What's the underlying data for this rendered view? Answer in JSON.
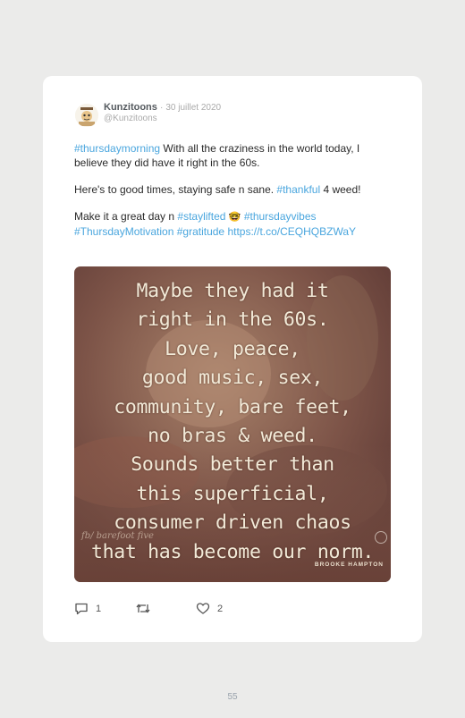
{
  "tweet": {
    "author_name": "Kunzitoons",
    "separator": "·",
    "date": "30 juillet 2020",
    "handle": "@Kunzitoons",
    "line1_tag": "#thursdaymorning",
    "line1_text": " With all the craziness in the world today, I believe they did have it right in the 60s.",
    "line2_text": "Here's to good times, staying safe n sane. ",
    "line2_tag": "#thankful",
    "line2_tail": " 4 weed!",
    "line3_text": "Make it a great day n ",
    "line3_tag1": "#staylifted",
    "line3_emoji": "🤓",
    "line3_tag2": " #thursdayvibes",
    "line3_tag3": "#ThursdayMotivation",
    "line3_tag4": " #gratitude",
    "line3_link": " https://t.co/CEQHQBZWaY"
  },
  "media": {
    "quote_lines": [
      "Maybe they had it",
      "right in the 60s.",
      "Love, peace,",
      "good music, sex,",
      "community, bare feet,",
      "no bras & weed.",
      "Sounds better than",
      "this superficial,",
      "consumer driven chaos",
      "that has become our norm."
    ],
    "signature": "fb/ barefoot five",
    "author": "BROOKE HAMPTON"
  },
  "actions": {
    "reply_count": "1",
    "retweet_count": "",
    "like_count": "2"
  },
  "footer": {
    "page_number": "55"
  }
}
